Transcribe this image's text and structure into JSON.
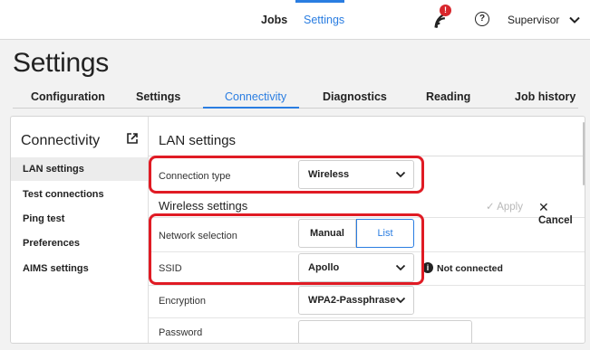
{
  "topbar": {
    "nav": [
      {
        "label": "Jobs"
      },
      {
        "label": "Settings"
      }
    ],
    "alert_badge": "!",
    "help_icon_label": "?",
    "user": "Supervisor",
    "icons": {
      "wifi": "wifi-icon",
      "help": "help-icon",
      "chevron": "chevron-down-icon"
    }
  },
  "page_title": "Settings",
  "tabs": [
    {
      "label": "Configuration"
    },
    {
      "label": "Settings"
    },
    {
      "label": "Connectivity"
    },
    {
      "label": "Diagnostics"
    },
    {
      "label": "Reading"
    },
    {
      "label": "Job history"
    }
  ],
  "sidebar": {
    "title": "Connectivity",
    "items": [
      {
        "label": "LAN settings"
      },
      {
        "label": "Test connections"
      },
      {
        "label": "Ping test"
      },
      {
        "label": "Preferences"
      },
      {
        "label": "AIMS settings"
      }
    ]
  },
  "main": {
    "section_title": "LAN settings",
    "connection_type_label": "Connection type",
    "connection_type_value": "Wireless",
    "wireless_title": "Wireless settings",
    "apply_label": "Apply",
    "cancel_label": "Cancel",
    "network_selection_label": "Network selection",
    "network_options": [
      "Manual",
      "List"
    ],
    "ssid_label": "SSID",
    "ssid_value": "Apollo",
    "ssid_status": "Not connected",
    "info_icon_label": "i",
    "encryption_label": "Encryption",
    "encryption_value": "WPA2-Passphrase",
    "password_label": "Password"
  },
  "colors": {
    "accent": "#2a7de1",
    "highlight": "#e01b24",
    "alert": "#d8262c"
  }
}
